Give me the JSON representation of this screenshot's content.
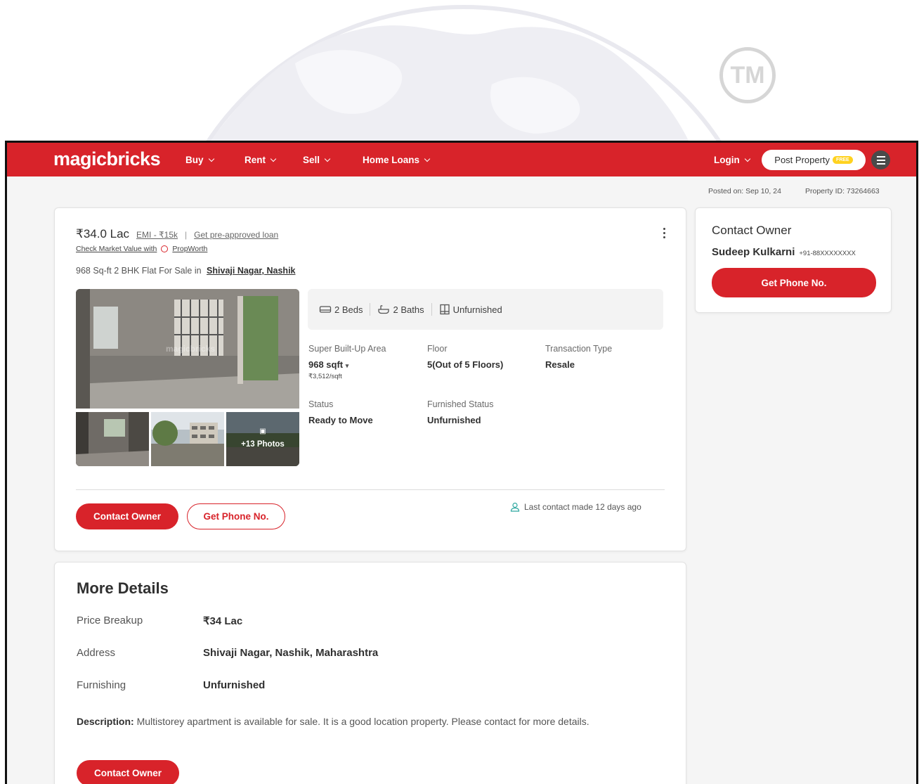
{
  "nav": {
    "logo": "magicbricks",
    "items": [
      "Buy",
      "Rent",
      "Sell",
      "Home Loans"
    ],
    "login": "Login",
    "post_property": "Post Property",
    "free_badge": "FREE"
  },
  "meta": {
    "posted_on": "Posted on: Sep 10, 24",
    "property_id": "Property ID: 73264663"
  },
  "listing": {
    "price": "₹34.0 Lac",
    "emi": "EMI - ₹15k",
    "preapproved": "Get pre-approved loan",
    "market_value": "Check Market Value with",
    "propworth": "PropWorth",
    "headline_prefix": "968 Sq-ft 2 BHK Flat For Sale in",
    "headline_location": "Shivaji Nagar, Nashik",
    "photo_watermark": "magicbricks",
    "more_photos": "+13 Photos",
    "summary": {
      "beds": "2 Beds",
      "baths": "2 Baths",
      "furnishing": "Unfurnished"
    },
    "attributes": [
      {
        "label": "Super Built-Up Area",
        "value": "968 sqft",
        "sub": "₹3,512/sqft"
      },
      {
        "label": "Floor",
        "value": "5(Out of 5 Floors)"
      },
      {
        "label": "Transaction Type",
        "value": "Resale"
      },
      {
        "label": "Status",
        "value": "Ready to Move"
      },
      {
        "label": "Furnished Status",
        "value": "Unfurnished"
      }
    ],
    "contact_owner": "Contact Owner",
    "get_phone": "Get Phone No.",
    "last_contact": "Last contact made 12 days ago"
  },
  "sidebar": {
    "title": "Contact Owner",
    "owner_name": "Sudeep Kulkarni",
    "owner_phone": "+91-88XXXXXXXX",
    "get_phone": "Get Phone No."
  },
  "more_details": {
    "title": "More Details",
    "rows": [
      {
        "label": "Price Breakup",
        "value": "₹34 Lac"
      },
      {
        "label": "Address",
        "value": "Shivaji Nagar, Nashik, Maharashtra"
      },
      {
        "label": "Furnishing",
        "value": "Unfurnished"
      }
    ],
    "description_label": "Description:",
    "description": "Multistorey apartment is available for sale. It is a good location property. Please contact for more details.",
    "contact_owner": "Contact Owner"
  },
  "watermark": "TM",
  "colors": {
    "brand": "#d8232a",
    "badge": "#ffd21f"
  }
}
